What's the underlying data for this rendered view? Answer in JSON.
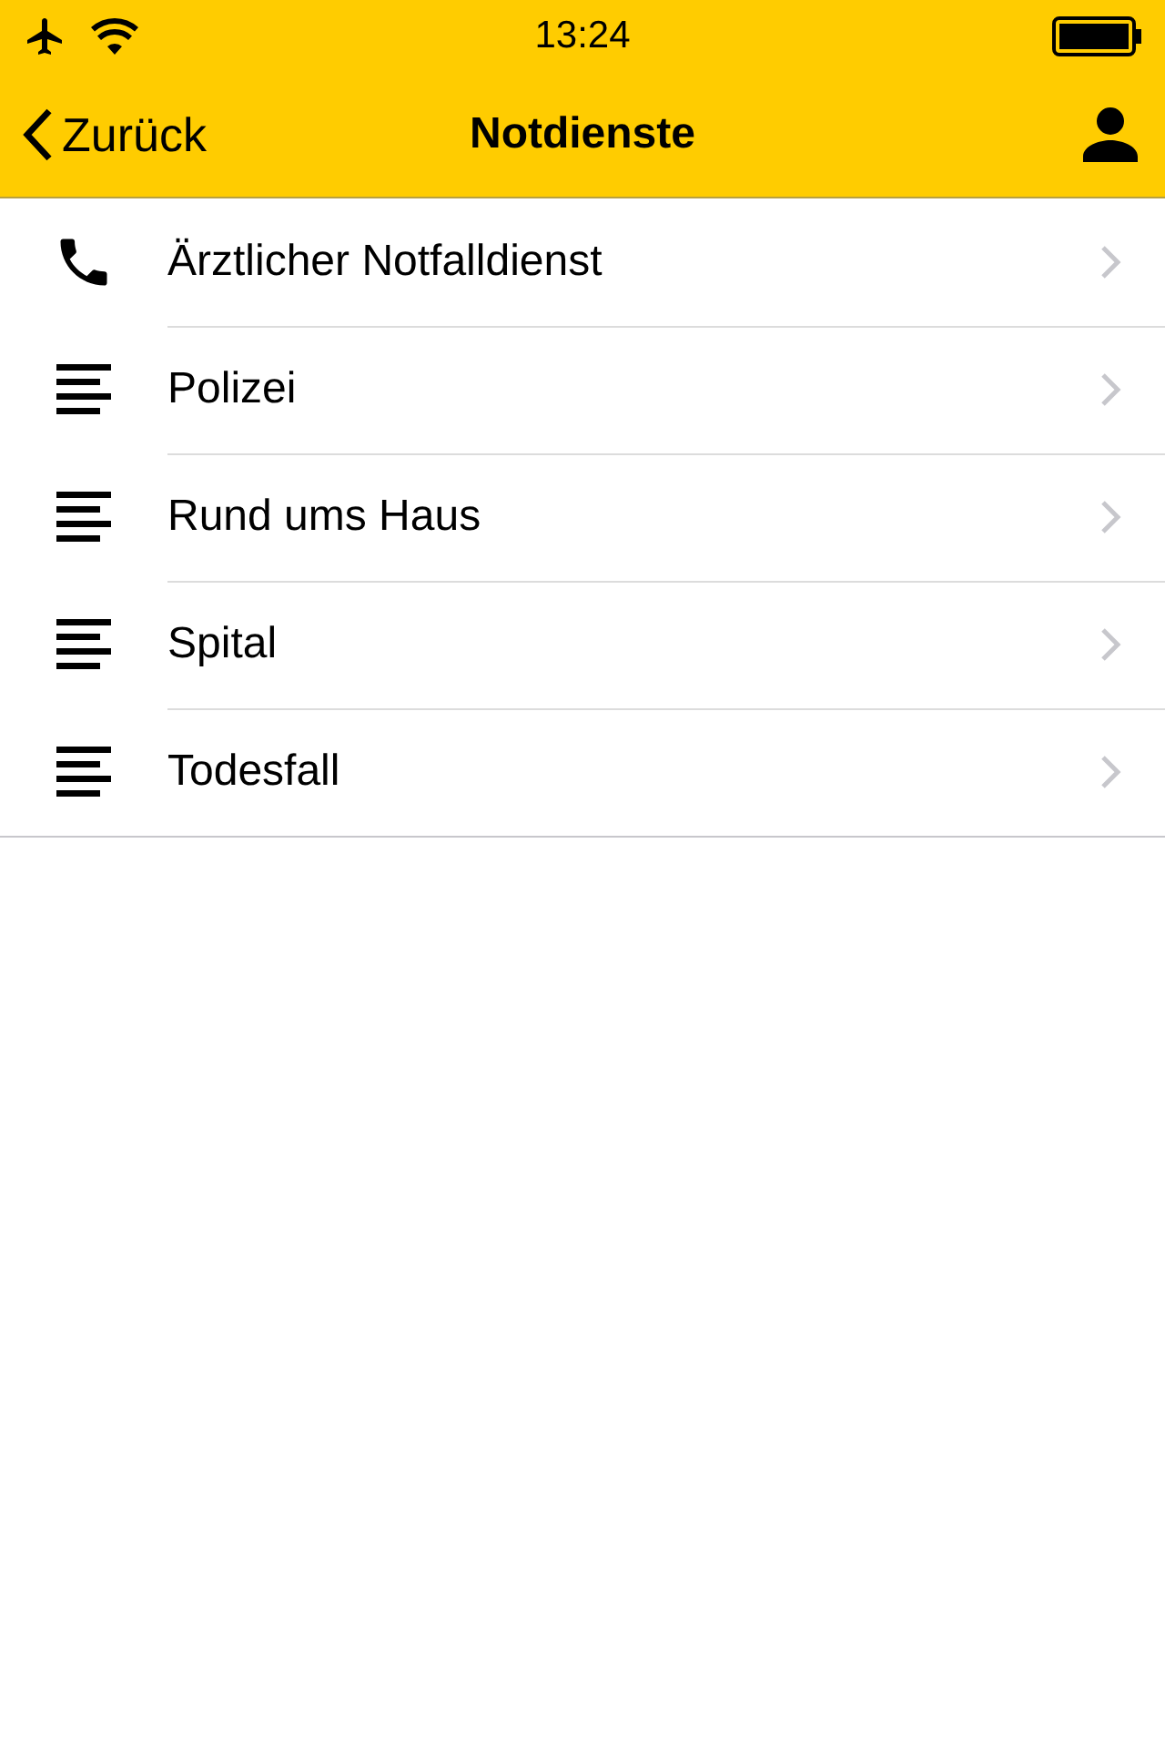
{
  "status_bar": {
    "time": "13:24"
  },
  "nav": {
    "back": "Zurück",
    "title": "Notdienste"
  },
  "items": [
    {
      "kind": "phone",
      "label": "Ärztlicher Notfalldienst"
    },
    {
      "kind": "text",
      "label": "Polizei"
    },
    {
      "kind": "text",
      "label": "Rund ums Haus"
    },
    {
      "kind": "text",
      "label": "Spital"
    },
    {
      "kind": "text",
      "label": "Todesfall"
    }
  ]
}
